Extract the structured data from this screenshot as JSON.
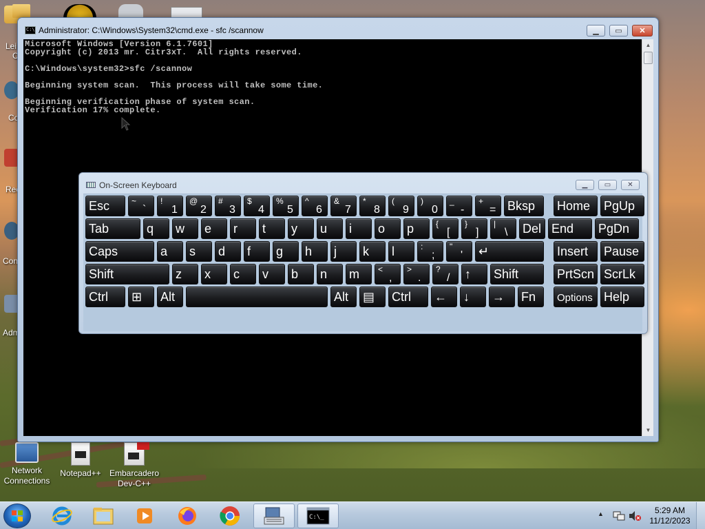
{
  "desktop": {
    "edge_labels": [
      "Lei",
      "C",
      "Co",
      "Rec",
      "Con",
      "Adm"
    ],
    "icons": [
      {
        "label_line1": "Network",
        "label_line2": "Connections"
      },
      {
        "label_line1": "Notepad++",
        "label_line2": ""
      },
      {
        "label_line1": "Embarcadero",
        "label_line2": "Dev-C++"
      }
    ]
  },
  "cmd": {
    "title": "Administrator: C:\\Windows\\System32\\cmd.exe - sfc  /scannow",
    "icon_text": "C:\\",
    "lines": [
      "Microsoft Windows [Version 6.1.7601]",
      "Copyright (c) 2013 mr. Citr3xT.  All rights reserved.",
      "",
      "C:\\Windows\\system32>sfc /scannow",
      "",
      "Beginning system scan.  This process will take some time.",
      "",
      "Beginning verification phase of system scan.",
      "Verification 17% complete."
    ]
  },
  "osk": {
    "title": "On-Screen Keyboard",
    "rows": [
      [
        {
          "main": "Esc"
        },
        {
          "top": "~",
          "bot": "`"
        },
        {
          "top": "!",
          "bot": "1"
        },
        {
          "top": "@",
          "bot": "2"
        },
        {
          "top": "#",
          "bot": "3"
        },
        {
          "top": "$",
          "bot": "4"
        },
        {
          "top": "%",
          "bot": "5"
        },
        {
          "top": "^",
          "bot": "6"
        },
        {
          "top": "&",
          "bot": "7"
        },
        {
          "top": "*",
          "bot": "8"
        },
        {
          "top": "(",
          "bot": "9"
        },
        {
          "top": ")",
          "bot": "0"
        },
        {
          "top": "_",
          "bot": "-"
        },
        {
          "top": "+",
          "bot": "="
        },
        {
          "main": "Bksp"
        },
        {
          "main": "Home"
        },
        {
          "main": "PgUp"
        }
      ],
      [
        {
          "main": "Tab"
        },
        {
          "main": "q"
        },
        {
          "main": "w"
        },
        {
          "main": "e"
        },
        {
          "main": "r"
        },
        {
          "main": "t"
        },
        {
          "main": "y"
        },
        {
          "main": "u"
        },
        {
          "main": "i"
        },
        {
          "main": "o"
        },
        {
          "main": "p"
        },
        {
          "top": "{",
          "bot": "["
        },
        {
          "top": "}",
          "bot": "]"
        },
        {
          "top": "|",
          "bot": "\\"
        },
        {
          "main": "Del"
        },
        {
          "main": "End"
        },
        {
          "main": "PgDn"
        }
      ],
      [
        {
          "main": "Caps"
        },
        {
          "main": "a"
        },
        {
          "main": "s"
        },
        {
          "main": "d"
        },
        {
          "main": "f"
        },
        {
          "main": "g"
        },
        {
          "main": "h"
        },
        {
          "main": "j"
        },
        {
          "main": "k"
        },
        {
          "main": "l"
        },
        {
          "top": ":",
          "bot": ";"
        },
        {
          "top": "\"",
          "bot": "'"
        },
        {
          "main": "↵"
        },
        {
          "main": "Insert"
        },
        {
          "main": "Pause"
        }
      ],
      [
        {
          "main": "Shift"
        },
        {
          "main": "z"
        },
        {
          "main": "x"
        },
        {
          "main": "c"
        },
        {
          "main": "v"
        },
        {
          "main": "b"
        },
        {
          "main": "n"
        },
        {
          "main": "m"
        },
        {
          "top": "<",
          "bot": ","
        },
        {
          "top": ">",
          "bot": "."
        },
        {
          "top": "?",
          "bot": "/"
        },
        {
          "main": "↑"
        },
        {
          "main": "Shift"
        },
        {
          "main": "PrtScn"
        },
        {
          "main": "ScrLk"
        }
      ],
      [
        {
          "main": "Ctrl"
        },
        {
          "main": "⊞"
        },
        {
          "main": "Alt"
        },
        {
          "main": ""
        },
        {
          "main": "Alt"
        },
        {
          "main": "▤"
        },
        {
          "main": "Ctrl"
        },
        {
          "main": "←"
        },
        {
          "main": "↓"
        },
        {
          "main": "→"
        },
        {
          "main": "Fn"
        },
        {
          "main": "Options"
        },
        {
          "main": "Help"
        }
      ]
    ]
  },
  "taskbar": {
    "items": [
      "internet-explorer-icon",
      "explorer-icon",
      "media-player-icon",
      "firefox-icon",
      "chrome-icon",
      "osk-icon",
      "cmd-icon"
    ],
    "active_index": 5,
    "time": "5:29 AM",
    "date": "11/12/2023"
  }
}
